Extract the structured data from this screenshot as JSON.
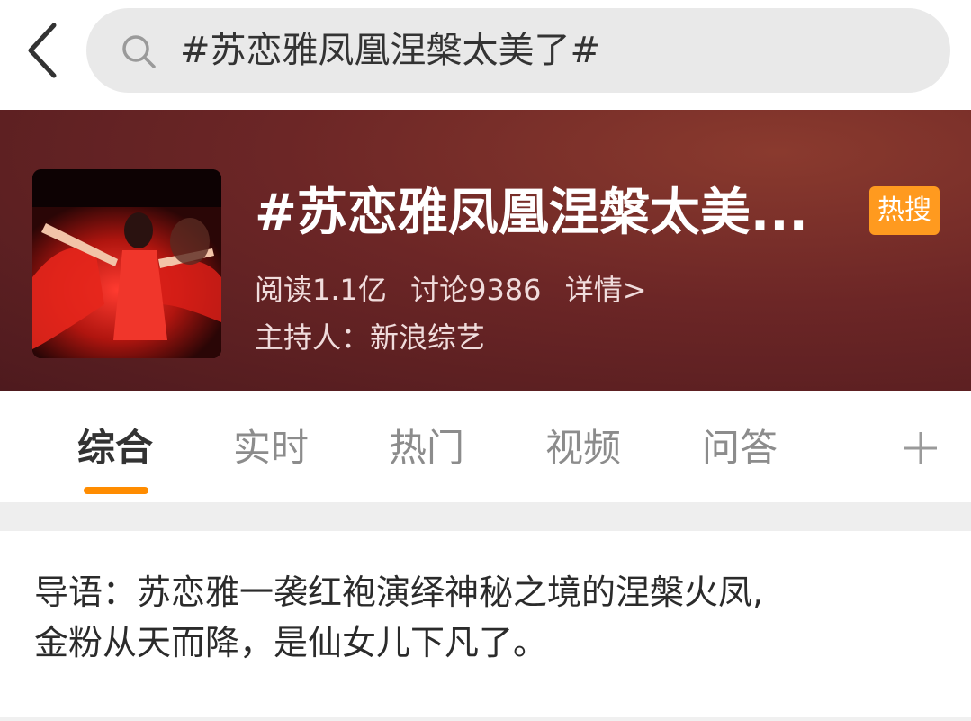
{
  "search": {
    "query": "#苏恋雅凤凰涅槃太美了#"
  },
  "topic": {
    "title": "#苏恋雅凤凰涅槃太美...",
    "badge": "热搜",
    "reads": "阅读1.1亿",
    "discussions": "讨论9386",
    "details": "详情>",
    "host": "主持人：新浪综艺"
  },
  "tabs": [
    {
      "label": "综合",
      "active": true
    },
    {
      "label": "实时",
      "active": false
    },
    {
      "label": "热门",
      "active": false
    },
    {
      "label": "视频",
      "active": false
    },
    {
      "label": "问答",
      "active": false
    }
  ],
  "intro": {
    "line1": "导语：苏恋雅一袭红袍演绎神秘之境的涅槃火凤,",
    "line2": "金粉从天而降，是仙女儿下凡了。"
  },
  "icons": {
    "back": "chevron-left-icon",
    "search": "search-icon",
    "more": "plus-icon"
  },
  "colors": {
    "accent": "#ff8c00",
    "badge": "#ff9a1f",
    "banner": "#6c2626"
  }
}
